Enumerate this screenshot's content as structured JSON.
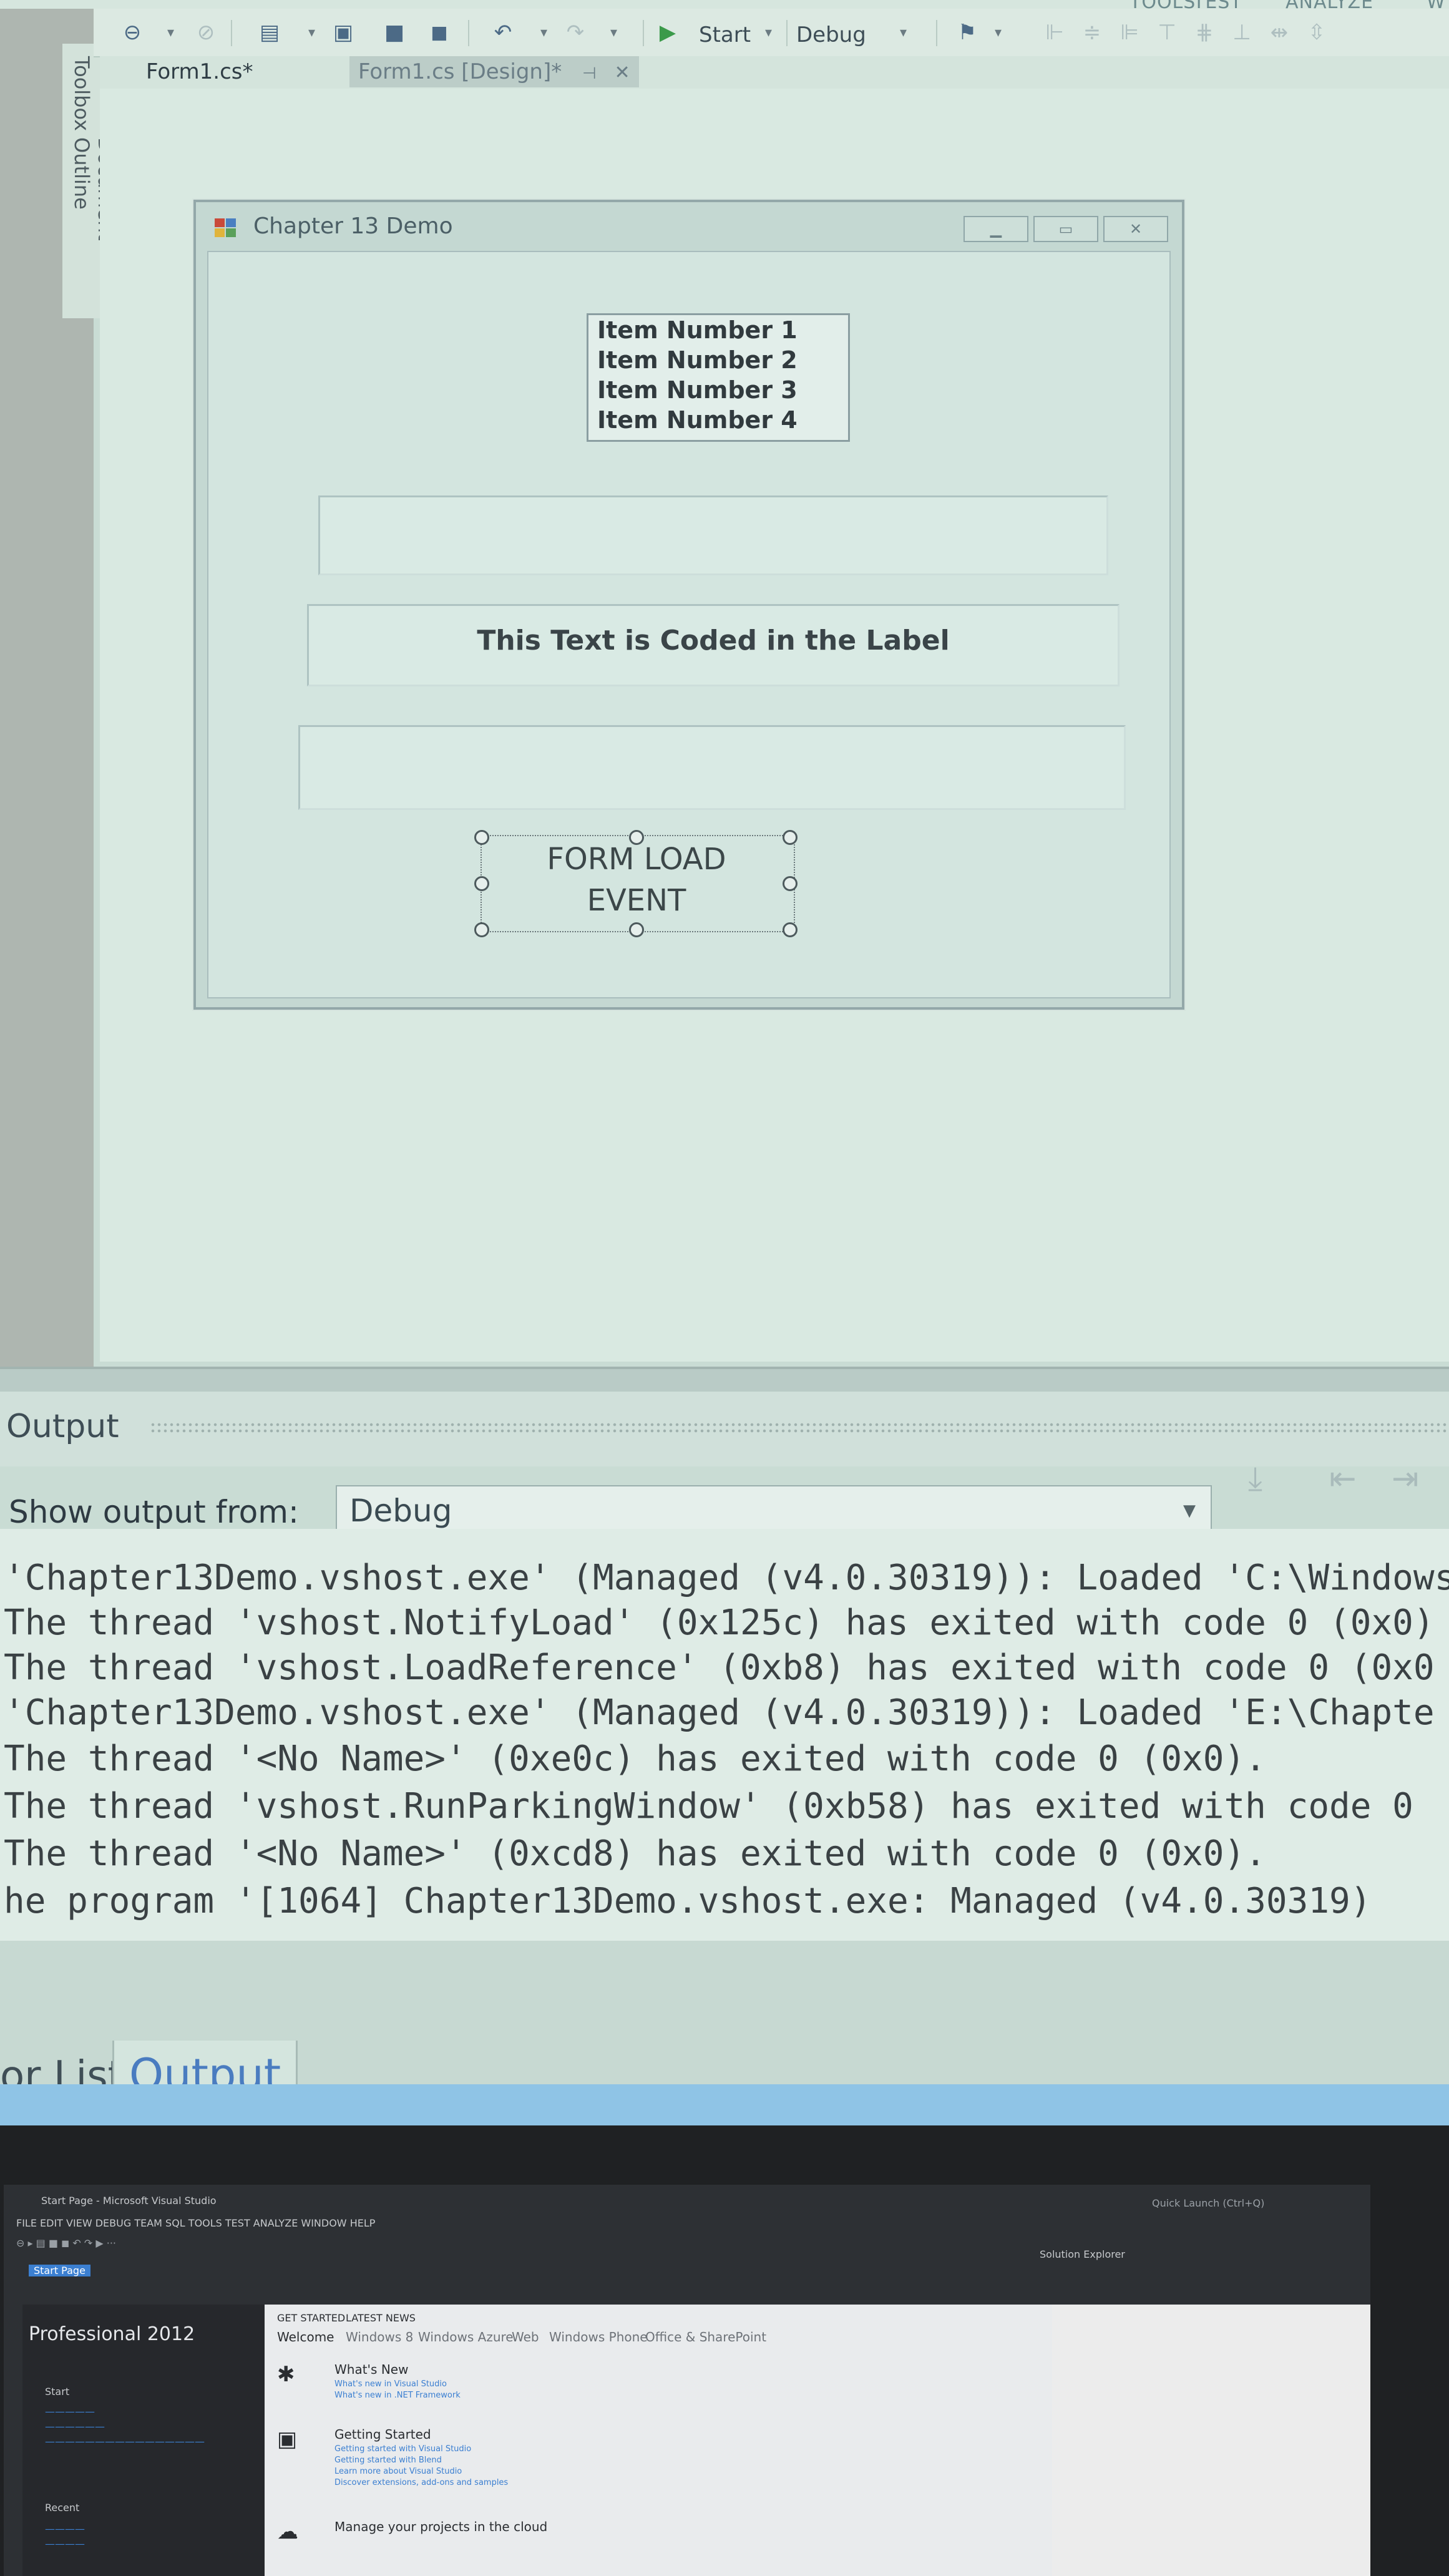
{
  "menu": {
    "items": [
      "TOOLS",
      "TEST",
      "ANALYZE",
      "W"
    ]
  },
  "toolbar": {
    "start_label": "Start",
    "config_label": "Debug"
  },
  "left_dock": {
    "toolbox_label": "Toolbox",
    "document_outline_label": "Document Outline"
  },
  "doc_tabs": {
    "code_tab": "Form1.cs*",
    "design_tab": "Form1.cs [Design]*",
    "pin_glyph": "⊣",
    "close_glyph": "✕"
  },
  "form": {
    "title": "Chapter 13 Demo",
    "listbox_items": [
      "Item Number 1",
      "Item Number 2",
      "Item Number 3",
      "Item Number 4"
    ],
    "label_text": "This Text is Coded in the Label",
    "button_line1": "FORM LOAD",
    "button_line2": "EVENT"
  },
  "output": {
    "title": "Output",
    "show_from_label": "Show output from:",
    "source_value": "Debug",
    "lines": [
      "'Chapter13Demo.vshost.exe' (Managed (v4.0.30319)): Loaded 'C:\\Windows",
      "The thread 'vshost.NotifyLoad' (0x125c) has exited with code 0 (0x0)",
      "The thread 'vshost.LoadReference' (0xb8) has exited with code 0 (0x0",
      "'Chapter13Demo.vshost.exe' (Managed (v4.0.30319)): Loaded 'E:\\Chapte",
      "The thread '<No Name>' (0xe0c) has exited with code 0 (0x0).",
      "The thread 'vshost.RunParkingWindow' (0xb58) has exited with code 0",
      "The thread '<No Name>' (0xcd8) has exited with code 0 (0x0).",
      "he program '[1064] Chapter13Demo.vshost.exe: Managed (v4.0.30319)"
    ]
  },
  "bottom_tabs": {
    "error_list": "or List",
    "output": "Output"
  },
  "laptop": {
    "window_title": "Start Page - Microsoft Visual Studio",
    "quick_launch": "Quick Launch (Ctrl+Q)",
    "menu": "FILE  EDIT  VIEW  DEBUG  TEAM  SQL  TOOLS  TEST  ANALYZE  WINDOW  HELP",
    "start_page_tab": "Start Page",
    "edition": "Professional 2012",
    "start_heading": "Start",
    "recent_heading": "Recent",
    "solution_explorer": "Solution Explorer",
    "top_links": [
      "GET STARTED",
      "LATEST NEWS"
    ],
    "nav_tabs": [
      "Welcome",
      "Windows 8",
      "Windows Azure",
      "Web",
      "Windows Phone",
      "Office & SharePoint"
    ],
    "whats_new": "What's New",
    "whats_new_links": [
      "What's new in Visual Studio",
      "What's new in .NET Framework"
    ],
    "getting_started": "Getting Started",
    "getting_started_links": [
      "Getting started with Visual Studio",
      "Getting started with Blend",
      "Learn more about Visual Studio",
      "Discover extensions, add-ons and samples"
    ],
    "manage_projects": "Manage your projects in the cloud"
  }
}
